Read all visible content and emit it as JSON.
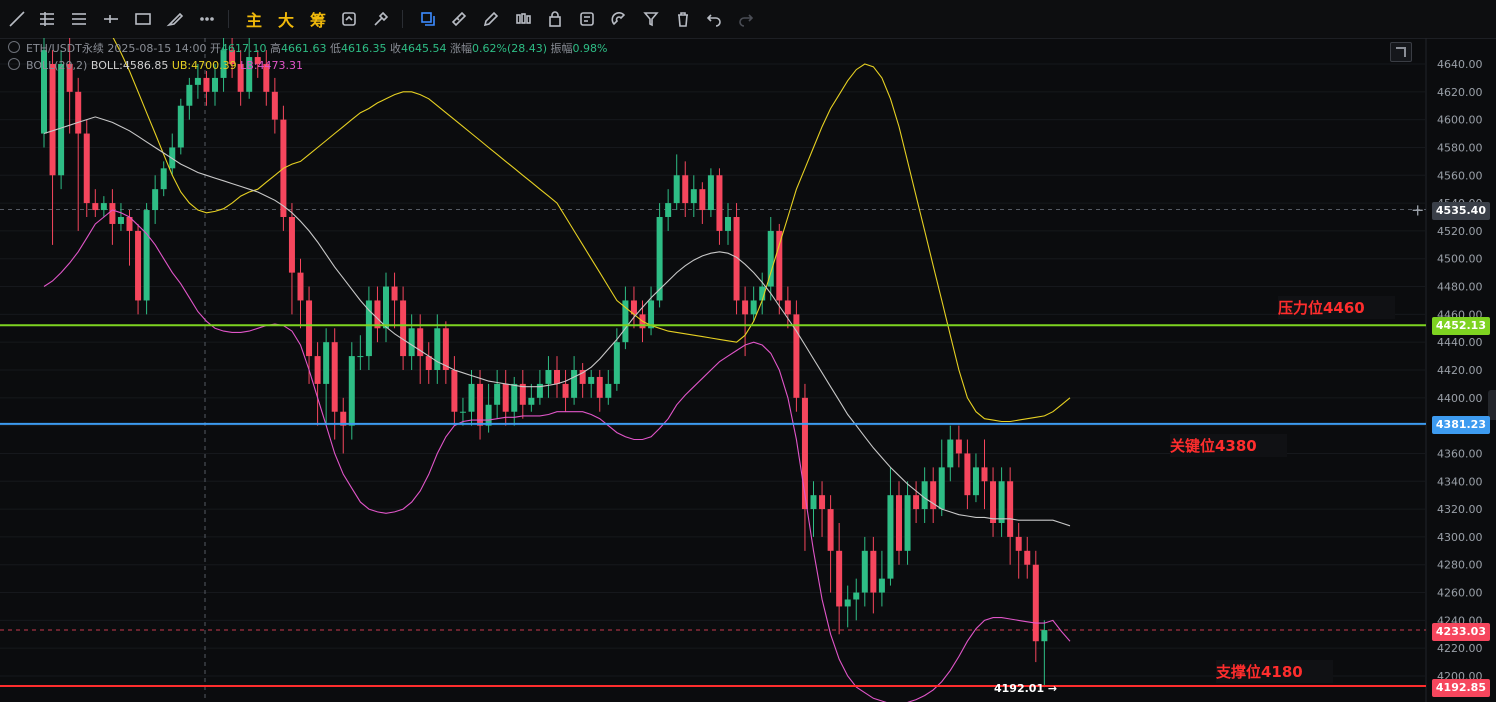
{
  "toolbar": {
    "text_buttons": [
      "主",
      "大",
      "筹"
    ]
  },
  "legend": {
    "symbol": "ETH/USDT永续",
    "datetime": "2025-08-15 14:00",
    "open_label": "开",
    "open": "4617.10",
    "high_label": "高",
    "high": "4661.63",
    "low_label": "低",
    "low": "4616.35",
    "close_label": "收",
    "close": "4645.54",
    "change_label": "涨幅",
    "change": "0.62%(28.43)",
    "amp_label": "振幅",
    "amp": "0.98%",
    "boll_name": "BOLL(20,2)",
    "boll_label": "BOLL:",
    "boll_mid": "4586.85",
    "ub_label": "UB:",
    "ub": "4700.39",
    "lb_label": "LB:",
    "lb": "4473.31"
  },
  "axis": {
    "min": 4180,
    "max": 4660,
    "ticks": [
      "4640.00",
      "4620.00",
      "4600.00",
      "4580.00",
      "4560.00",
      "4540.00",
      "4520.00",
      "4500.00",
      "4480.00",
      "4460.00",
      "4440.00",
      "4420.00",
      "4400.00",
      "4380.00",
      "4360.00",
      "4340.00",
      "4320.00",
      "4300.00",
      "4280.00",
      "4260.00",
      "4240.00",
      "4220.00",
      "4200.00"
    ]
  },
  "price_tags": {
    "crosshair": "4535.40",
    "resistance_line": "4452.13",
    "key_line": "4381.23",
    "current": "4233.03",
    "support_line": "4192.85",
    "low_marker": "4192.01 →"
  },
  "annotations": {
    "resistance": "压力位4460",
    "key": "关键位4380",
    "support": "支撑位4180"
  },
  "colors": {
    "up": "#2ebd85",
    "down": "#f6465d",
    "ub": "#e6d022",
    "mid": "#c8c8c8",
    "lb": "#e055c8",
    "resistance": "#7ed321",
    "key": "#3d9bf0",
    "support": "#ff2d2d"
  },
  "candles": [
    [
      4590,
      4650,
      4580,
      4660
    ],
    [
      4640,
      4560,
      4510,
      4650
    ],
    [
      4560,
      4640,
      4550,
      4650
    ],
    [
      4640,
      4620,
      4590,
      4660
    ],
    [
      4620,
      4590,
      4520,
      4630
    ],
    [
      4590,
      4540,
      4530,
      4600
    ],
    [
      4540,
      4535,
      4530,
      4550
    ],
    [
      4535,
      4540,
      4530,
      4545
    ],
    [
      4540,
      4525,
      4510,
      4550
    ],
    [
      4525,
      4530,
      4520,
      4540
    ],
    [
      4530,
      4520,
      4495,
      4535
    ],
    [
      4520,
      4470,
      4460,
      4525
    ],
    [
      4470,
      4535,
      4460,
      4540
    ],
    [
      4535,
      4550,
      4525,
      4560
    ],
    [
      4550,
      4565,
      4545,
      4570
    ],
    [
      4565,
      4580,
      4560,
      4590
    ],
    [
      4580,
      4610,
      4575,
      4615
    ],
    [
      4610,
      4625,
      4600,
      4630
    ],
    [
      4625,
      4630,
      4615,
      4640
    ],
    [
      4630,
      4620,
      4610,
      4635
    ],
    [
      4620,
      4630,
      4610,
      4640
    ],
    [
      4630,
      4650,
      4620,
      4660
    ],
    [
      4650,
      4640,
      4630,
      4660
    ],
    [
      4640,
      4620,
      4610,
      4650
    ],
    [
      4620,
      4645,
      4615,
      4660
    ],
    [
      4645,
      4640,
      4630,
      4650
    ],
    [
      4640,
      4620,
      4610,
      4650
    ],
    [
      4620,
      4600,
      4590,
      4630
    ],
    [
      4600,
      4530,
      4520,
      4610
    ],
    [
      4530,
      4490,
      4460,
      4540
    ],
    [
      4490,
      4470,
      4450,
      4500
    ],
    [
      4470,
      4430,
      4410,
      4480
    ],
    [
      4430,
      4410,
      4380,
      4440
    ],
    [
      4410,
      4440,
      4380,
      4450
    ],
    [
      4440,
      4390,
      4370,
      4450
    ],
    [
      4390,
      4380,
      4360,
      4400
    ],
    [
      4380,
      4430,
      4370,
      4440
    ],
    [
      4430,
      4430,
      4420,
      4445
    ],
    [
      4430,
      4470,
      4420,
      4480
    ],
    [
      4470,
      4450,
      4440,
      4480
    ],
    [
      4450,
      4480,
      4440,
      4490
    ],
    [
      4480,
      4470,
      4450,
      4490
    ],
    [
      4470,
      4430,
      4420,
      4480
    ],
    [
      4430,
      4450,
      4420,
      4460
    ],
    [
      4450,
      4430,
      4410,
      4460
    ],
    [
      4430,
      4420,
      4410,
      4440
    ],
    [
      4420,
      4450,
      4410,
      4460
    ],
    [
      4450,
      4420,
      4410,
      4455
    ],
    [
      4420,
      4390,
      4380,
      4430
    ],
    [
      4390,
      4390,
      4380,
      4400
    ],
    [
      4390,
      4410,
      4380,
      4420
    ],
    [
      4410,
      4380,
      4370,
      4420
    ],
    [
      4380,
      4395,
      4375,
      4410
    ],
    [
      4395,
      4410,
      4385,
      4420
    ],
    [
      4410,
      4390,
      4380,
      4420
    ],
    [
      4390,
      4410,
      4380,
      4415
    ],
    [
      4410,
      4395,
      4385,
      4420
    ],
    [
      4395,
      4400,
      4390,
      4410
    ],
    [
      4400,
      4410,
      4395,
      4420
    ],
    [
      4410,
      4420,
      4400,
      4430
    ],
    [
      4420,
      4410,
      4400,
      4430
    ],
    [
      4410,
      4400,
      4390,
      4420
    ],
    [
      4400,
      4420,
      4395,
      4430
    ],
    [
      4420,
      4410,
      4400,
      4425
    ],
    [
      4410,
      4415,
      4400,
      4420
    ],
    [
      4415,
      4400,
      4390,
      4420
    ],
    [
      4400,
      4410,
      4395,
      4420
    ],
    [
      4410,
      4440,
      4405,
      4450
    ],
    [
      4440,
      4470,
      4435,
      4480
    ],
    [
      4470,
      4460,
      4450,
      4480
    ],
    [
      4460,
      4450,
      4440,
      4470
    ],
    [
      4450,
      4470,
      4445,
      4480
    ],
    [
      4470,
      4530,
      4465,
      4540
    ],
    [
      4530,
      4540,
      4520,
      4550
    ],
    [
      4540,
      4560,
      4535,
      4575
    ],
    [
      4560,
      4540,
      4530,
      4570
    ],
    [
      4540,
      4550,
      4530,
      4560
    ],
    [
      4550,
      4535,
      4525,
      4555
    ],
    [
      4535,
      4560,
      4530,
      4565
    ],
    [
      4560,
      4520,
      4510,
      4565
    ],
    [
      4520,
      4530,
      4510,
      4540
    ],
    [
      4530,
      4470,
      4460,
      4540
    ],
    [
      4470,
      4460,
      4430,
      4480
    ],
    [
      4460,
      4470,
      4455,
      4480
    ],
    [
      4470,
      4480,
      4460,
      4490
    ],
    [
      4480,
      4520,
      4470,
      4530
    ],
    [
      4520,
      4470,
      4460,
      4525
    ],
    [
      4470,
      4460,
      4450,
      4480
    ],
    [
      4460,
      4400,
      4390,
      4470
    ],
    [
      4400,
      4320,
      4290,
      4410
    ],
    [
      4320,
      4330,
      4300,
      4340
    ],
    [
      4330,
      4320,
      4300,
      4340
    ],
    [
      4320,
      4290,
      4260,
      4330
    ],
    [
      4290,
      4250,
      4230,
      4310
    ],
    [
      4250,
      4255,
      4235,
      4265
    ],
    [
      4255,
      4260,
      4240,
      4270
    ],
    [
      4260,
      4290,
      4250,
      4300
    ],
    [
      4290,
      4260,
      4245,
      4300
    ],
    [
      4260,
      4270,
      4250,
      4290
    ],
    [
      4270,
      4330,
      4265,
      4350
    ],
    [
      4330,
      4290,
      4280,
      4340
    ],
    [
      4290,
      4330,
      4280,
      4340
    ],
    [
      4330,
      4320,
      4310,
      4340
    ],
    [
      4320,
      4340,
      4310,
      4350
    ],
    [
      4340,
      4320,
      4310,
      4350
    ],
    [
      4320,
      4350,
      4315,
      4370
    ],
    [
      4350,
      4370,
      4340,
      4380
    ],
    [
      4370,
      4360,
      4350,
      4380
    ],
    [
      4360,
      4330,
      4320,
      4370
    ],
    [
      4330,
      4350,
      4325,
      4360
    ],
    [
      4350,
      4340,
      4320,
      4370
    ],
    [
      4340,
      4310,
      4300,
      4350
    ],
    [
      4310,
      4340,
      4300,
      4350
    ],
    [
      4340,
      4300,
      4280,
      4350
    ],
    [
      4300,
      4290,
      4270,
      4310
    ],
    [
      4290,
      4280,
      4270,
      4300
    ],
    [
      4280,
      4225,
      4210,
      4290
    ],
    [
      4225,
      4233,
      4192,
      4240
    ]
  ],
  "boll_ub": [
    4700,
    4700,
    4698,
    4695,
    4690,
    4685,
    4678,
    4670,
    4660,
    4648,
    4635,
    4620,
    4605,
    4590,
    4575,
    4560,
    4548,
    4540,
    4535,
    4533,
    4534,
    4536,
    4540,
    4545,
    4548,
    4550,
    4555,
    4560,
    4565,
    4568,
    4570,
    4575,
    4580,
    4585,
    4590,
    4595,
    4600,
    4605,
    4608,
    4612,
    4615,
    4618,
    4620,
    4620,
    4618,
    4615,
    4610,
    4605,
    4600,
    4595,
    4590,
    4585,
    4580,
    4575,
    4570,
    4565,
    4560,
    4555,
    4550,
    4545,
    4540,
    4530,
    4520,
    4510,
    4500,
    4490,
    4480,
    4470,
    4465,
    4460,
    4455,
    4452,
    4450,
    4448,
    4447,
    4446,
    4445,
    4444,
    4443,
    4442,
    4441,
    4440,
    4445,
    4455,
    4470,
    4490,
    4510,
    4530,
    4550,
    4565,
    4580,
    4595,
    4608,
    4618,
    4628,
    4636,
    4640,
    4638,
    4630,
    4615,
    4595,
    4570,
    4545,
    4520,
    4495,
    4470,
    4445,
    4420,
    4400,
    4390,
    4385,
    4384,
    4383,
    4383,
    4384,
    4385,
    4386,
    4387,
    4390,
    4395,
    4400
  ],
  "boll_mid": [
    4590,
    4592,
    4594,
    4596,
    4598,
    4600,
    4602,
    4600,
    4598,
    4595,
    4592,
    4588,
    4584,
    4580,
    4576,
    4572,
    4568,
    4565,
    4562,
    4560,
    4558,
    4556,
    4554,
    4552,
    4550,
    4548,
    4545,
    4542,
    4538,
    4533,
    4527,
    4520,
    4512,
    4503,
    4494,
    4486,
    4478,
    4470,
    4463,
    4457,
    4451,
    4446,
    4442,
    4438,
    4434,
    4430,
    4426,
    4423,
    4420,
    4418,
    4416,
    4414,
    4412,
    4411,
    4410,
    4409,
    4408,
    4408,
    4408,
    4409,
    4410,
    4412,
    4415,
    4418,
    4422,
    4428,
    4435,
    4442,
    4450,
    4458,
    4465,
    4472,
    4478,
    4484,
    4490,
    4495,
    4499,
    4502,
    4504,
    4505,
    4504,
    4501,
    4496,
    4490,
    4483,
    4475,
    4466,
    4457,
    4448,
    4438,
    4428,
    4418,
    4408,
    4398,
    4388,
    4380,
    4372,
    4364,
    4357,
    4350,
    4344,
    4338,
    4333,
    4328,
    4324,
    4320,
    4318,
    4316,
    4315,
    4314,
    4314,
    4313,
    4313,
    4313,
    4312,
    4312,
    4312,
    4312,
    4312,
    4310,
    4308
  ],
  "boll_lb": [
    4480,
    4484,
    4490,
    4497,
    4505,
    4515,
    4525,
    4530,
    4535,
    4533,
    4530,
    4524,
    4518,
    4510,
    4500,
    4490,
    4482,
    4472,
    4462,
    4455,
    4450,
    4448,
    4447,
    4447,
    4448,
    4450,
    4452,
    4453,
    4452,
    4448,
    4438,
    4420,
    4400,
    4380,
    4360,
    4345,
    4335,
    4325,
    4320,
    4318,
    4317,
    4318,
    4320,
    4325,
    4333,
    4345,
    4360,
    4372,
    4380,
    4383,
    4384,
    4384,
    4384,
    4385,
    4386,
    4386,
    4387,
    4387,
    4387,
    4388,
    4390,
    4390,
    4390,
    4390,
    4388,
    4385,
    4380,
    4375,
    4372,
    4370,
    4370,
    4372,
    4378,
    4385,
    4395,
    4402,
    4408,
    4414,
    4420,
    4426,
    4430,
    4434,
    4438,
    4440,
    4438,
    4432,
    4420,
    4400,
    4370,
    4330,
    4290,
    4255,
    4230,
    4212,
    4200,
    4192,
    4188,
    4184,
    4182,
    4180,
    4180,
    4181,
    4183,
    4186,
    4190,
    4196,
    4204,
    4214,
    4225,
    4234,
    4240,
    4242,
    4242,
    4241,
    4240,
    4239,
    4238,
    4238,
    4240,
    4232,
    4225
  ]
}
